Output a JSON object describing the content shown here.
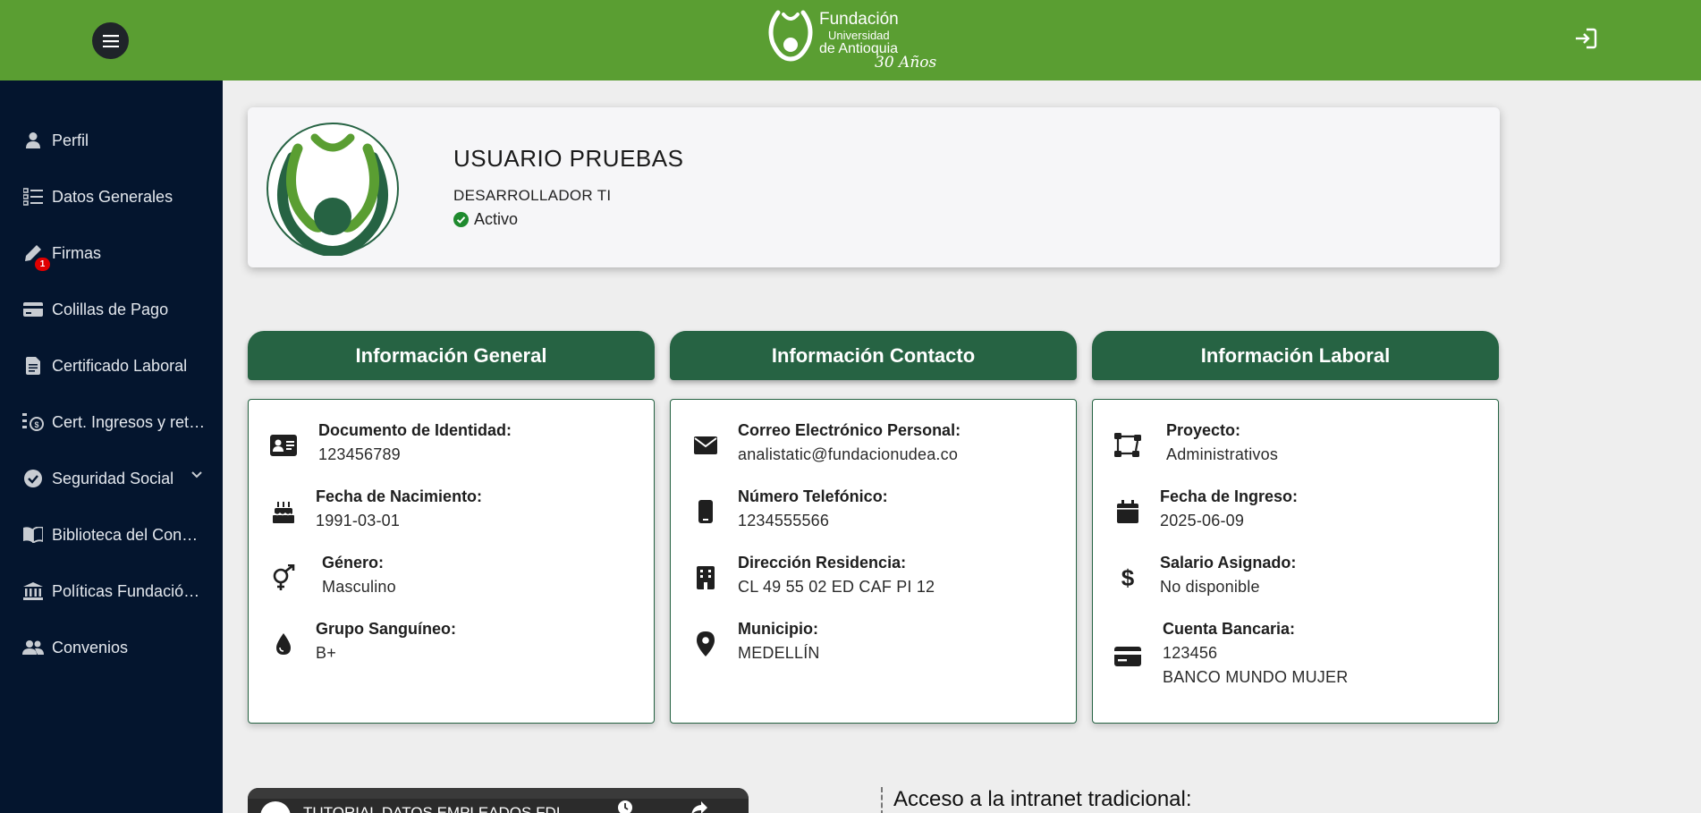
{
  "header": {
    "brand": {
      "line1": "Fundación",
      "line2": "Universidad",
      "line3": "de Antioquia",
      "anniversary": "30 Años"
    },
    "colors": {
      "brand_green": "#5a9e32",
      "dark_green": "#266343",
      "sidebar_bg": "#04152e"
    }
  },
  "sidebar": {
    "items": [
      {
        "label": "Perfil",
        "icon": "user-icon"
      },
      {
        "label": "Datos Generales",
        "icon": "checklist-icon"
      },
      {
        "label": "Firmas",
        "icon": "pen-icon",
        "badge": "1"
      },
      {
        "label": "Colillas de Pago",
        "icon": "credit-card-icon"
      },
      {
        "label": "Certificado Laboral",
        "icon": "document-icon"
      },
      {
        "label": "Cert. Ingresos y retenciones",
        "icon": "money-report-icon"
      },
      {
        "label": "Seguridad Social",
        "icon": "shield-check-icon"
      },
      {
        "label": "Biblioteca del Conocimiento",
        "icon": "book-icon"
      },
      {
        "label": "Políticas Fundación UdeA",
        "icon": "institution-icon"
      },
      {
        "label": "Convenios",
        "icon": "users-icon"
      }
    ]
  },
  "profile": {
    "name": "USUARIO PRUEBAS",
    "role": "DESARROLLADOR TI",
    "status": "Activo"
  },
  "sections": {
    "general": {
      "title": "Información General",
      "rows": [
        {
          "label": "Documento de Identidad:",
          "value": "123456789",
          "icon": "id-card-icon"
        },
        {
          "label": "Fecha de Nacimiento:",
          "value": "1991-03-01",
          "icon": "birthday-cake-icon"
        },
        {
          "label": "Género:",
          "value": "Masculino",
          "icon": "gender-icon"
        },
        {
          "label": "Grupo Sanguíneo:",
          "value": "B+",
          "icon": "blood-drop-icon"
        }
      ]
    },
    "contact": {
      "title": "Información Contacto",
      "rows": [
        {
          "label": "Correo Electrónico Personal:",
          "value": "analistatic@fundacionudea.co",
          "icon": "envelope-icon"
        },
        {
          "label": "Número Telefónico:",
          "value": "1234555566",
          "icon": "mobile-phone-icon"
        },
        {
          "label": "Dirección Residencia:",
          "value": "CL 49 55 02 ED CAF PI 12",
          "icon": "building-icon"
        },
        {
          "label": "Municipio:",
          "value": "MEDELLÍN",
          "icon": "map-pin-icon"
        }
      ]
    },
    "labor": {
      "title": "Información Laboral",
      "rows": [
        {
          "label": "Proyecto:",
          "value": "Administrativos",
          "icon": "project-diagram-icon"
        },
        {
          "label": "Fecha de Ingreso:",
          "value": "2025-06-09",
          "icon": "calendar-icon"
        },
        {
          "label": "Salario Asignado:",
          "value": "No disponible",
          "icon": "dollar-icon"
        },
        {
          "label": "Cuenta Bancaria:",
          "value": "123456",
          "value2": "BANCO MUNDO MUJER",
          "icon": "bank-card-icon"
        }
      ]
    }
  },
  "bottom": {
    "video_title": "TUTORIAL DATOS EMPLEADOS FDI",
    "intranet_title": "Acceso a la intranet tradicional:"
  }
}
